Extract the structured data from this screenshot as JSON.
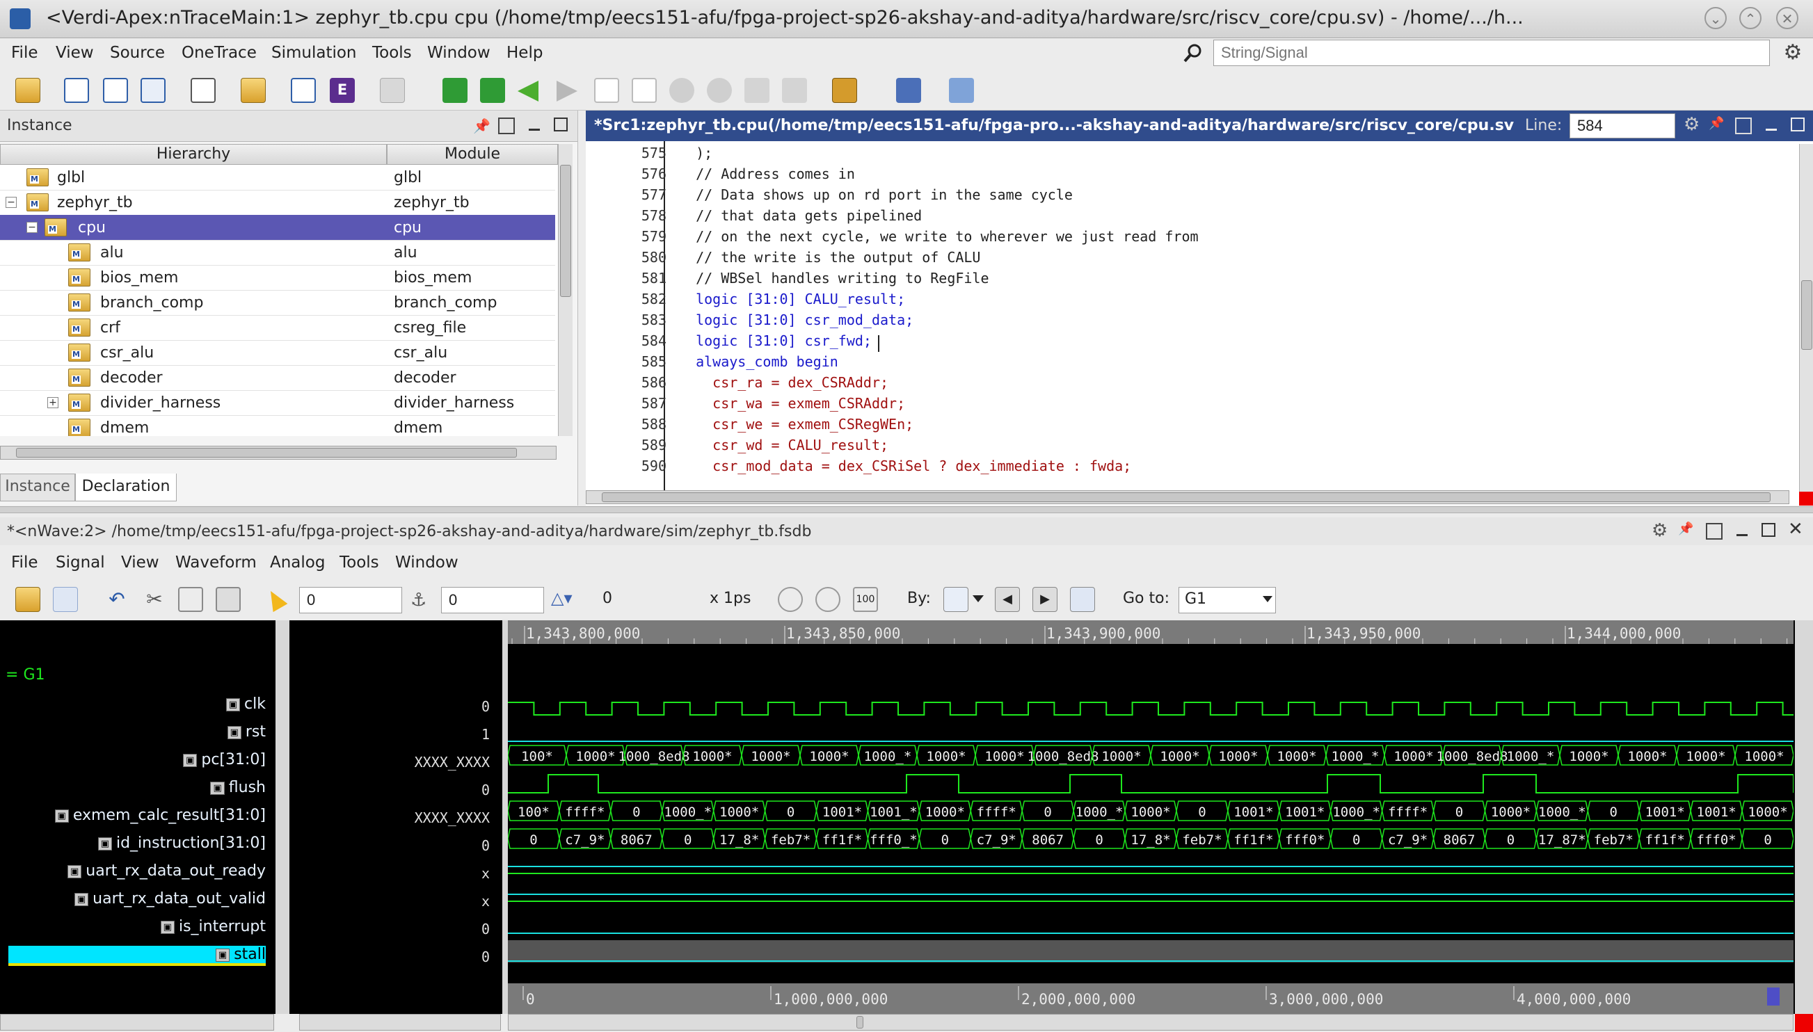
{
  "window": {
    "title": "<Verdi-Apex:nTraceMain:1> zephyr_tb.cpu cpu (/home/tmp/eecs151-afu/fpga-project-sp26-akshay-and-aditya/hardware/src/riscv_core/cpu.sv) - /home/.../h..."
  },
  "main_menu": [
    "File",
    "View",
    "Source",
    "OneTrace",
    "Simulation",
    "Tools",
    "Window",
    "Help"
  ],
  "search": {
    "placeholder": "String/Signal"
  },
  "instance_panel": {
    "title": "Instance",
    "col_hierarchy": "Hierarchy",
    "col_module": "Module",
    "rows": [
      {
        "name": "glbl",
        "module": "glbl",
        "indent": 0
      },
      {
        "name": "zephyr_tb",
        "module": "zephyr_tb",
        "indent": 0
      },
      {
        "name": "cpu",
        "module": "cpu",
        "indent": 1
      },
      {
        "name": "alu",
        "module": "alu",
        "indent": 2
      },
      {
        "name": "bios_mem",
        "module": "bios_mem",
        "indent": 2
      },
      {
        "name": "branch_comp",
        "module": "branch_comp",
        "indent": 2
      },
      {
        "name": "crf",
        "module": "csreg_file",
        "indent": 2
      },
      {
        "name": "csr_alu",
        "module": "csr_alu",
        "indent": 2
      },
      {
        "name": "decoder",
        "module": "decoder",
        "indent": 2
      },
      {
        "name": "divider_harness",
        "module": "divider_harness",
        "indent": 2
      },
      {
        "name": "dmem",
        "module": "dmem",
        "indent": 2
      }
    ],
    "tabs": [
      "Instance",
      "Declaration"
    ]
  },
  "source_panel": {
    "title": "*Src1:zephyr_tb.cpu(/home/tmp/eecs151-afu/fpga-pro...-akshay-and-aditya/hardware/src/riscv_core/cpu.sv",
    "line_label": "Line:",
    "line_value": "584",
    "lines": [
      {
        "n": "575",
        "t": "  );"
      },
      {
        "n": "576",
        "t": "  // Address comes in"
      },
      {
        "n": "577",
        "t": "  // Data shows up on rd port in the same cycle"
      },
      {
        "n": "578",
        "t": "  // that data gets pipelined"
      },
      {
        "n": "579",
        "t": "  // on the next cycle, we write to wherever we just read from"
      },
      {
        "n": "580",
        "t": "  // the write is the output of CALU"
      },
      {
        "n": "581",
        "t": "  // WBSel handles writing to RegFile"
      },
      {
        "n": "582",
        "t": "  logic [31:0] CALU_result;"
      },
      {
        "n": "583",
        "t": "  logic [31:0] csr_mod_data;"
      },
      {
        "n": "584",
        "t": "  logic [31:0] csr_fwd;"
      },
      {
        "n": "585",
        "t": "  always_comb begin"
      },
      {
        "n": "586",
        "t": "    csr_ra = dex_CSRAddr;"
      },
      {
        "n": "587",
        "t": "    csr_wa = exmem_CSRAddr;"
      },
      {
        "n": "588",
        "t": "    csr_we = exmem_CSRegWEn;"
      },
      {
        "n": "589",
        "t": "    csr_wd = CALU_result;"
      },
      {
        "n": "590",
        "t": "    csr_mod_data = dex_CSRiSel ? dex_immediate : fwda;"
      }
    ]
  },
  "nwave": {
    "title": "*<nWave:2> /home/tmp/eecs151-afu/fpga-project-sp26-akshay-and-aditya/hardware/sim/zephyr_tb.fsdb",
    "menu": [
      "File",
      "Signal",
      "View",
      "Waveform",
      "Analog",
      "Tools",
      "Window"
    ],
    "cursor_value": "0",
    "marker_value": "0",
    "delta_value": "0",
    "unit": "x 1ps",
    "by_label": "By:",
    "goto_label": "Go to:",
    "goto_value": "G1",
    "group": "G1",
    "signals": [
      {
        "name": "clk",
        "value": "0",
        "kind": "1bit"
      },
      {
        "name": "rst",
        "value": "1",
        "kind": "1bit"
      },
      {
        "name": "pc[31:0]",
        "value": "XXXX_XXXX",
        "kind": "bus"
      },
      {
        "name": "flush",
        "value": "0",
        "kind": "1bit"
      },
      {
        "name": "exmem_calc_result[31:0]",
        "value": "XXXX_XXXX",
        "kind": "bus"
      },
      {
        "name": "id_instruction[31:0]",
        "value": "0",
        "kind": "bus"
      },
      {
        "name": "uart_rx_data_out_ready",
        "value": "x",
        "kind": "1bit"
      },
      {
        "name": "uart_rx_data_out_valid",
        "value": "x",
        "kind": "1bit"
      },
      {
        "name": "is_interrupt",
        "value": "0",
        "kind": "1bit"
      },
      {
        "name": "stall",
        "value": "0",
        "kind": "1bit"
      }
    ],
    "timeline_ticks": [
      "1,343,800,000",
      "1,343,850,000",
      "1,343,900,000",
      "1,343,950,000",
      "1,344,000,000"
    ],
    "overview_ticks": [
      "0",
      "1,000,000,000",
      "2,000,000,000",
      "3,000,000,000",
      "4,000,000,000"
    ],
    "pc_labels": [
      "100*",
      "1000*",
      "1000_8ed8",
      "1000*",
      "1000*",
      "1000*",
      "1000_*",
      "1000*",
      "1000*",
      "1000_8ed8",
      "1000*",
      "1000*",
      "1000*",
      "1000*",
      "1000_*",
      "1000*",
      "1000_8ed8",
      "1000_*",
      "1000*",
      "1000*",
      "1000*",
      "1000*"
    ],
    "exmem_labels": [
      "100*",
      "ffff*",
      "0",
      "1000_*",
      "1000*",
      "0",
      "1001*",
      "1001_*",
      "1000*",
      "ffff*",
      "0",
      "1000_*",
      "1000*",
      "0",
      "1001*",
      "1001*",
      "1000_*",
      "ffff*",
      "0",
      "1000*",
      "1000_*",
      "0",
      "1001*",
      "1001*",
      "1000*"
    ],
    "instr_labels": [
      "0",
      "c7_9*",
      "8067",
      "0",
      "17_8*",
      "feb7*",
      "ff1f*",
      "fff0_*",
      "0",
      "c7_9*",
      "8067",
      "0",
      "17_8*",
      "feb7*",
      "ff1f*",
      "fff0*",
      "0",
      "c7_9*",
      "8067",
      "0",
      "17_87*",
      "feb7*",
      "ff1f*",
      "fff0*",
      "0"
    ]
  },
  "colors": {
    "wave_bg": "#000000",
    "wave_green": "#1ee81e",
    "wave_cyan": "#19e0e0",
    "selection": "#5b57b3",
    "stall_highlight": "#00e5ff"
  }
}
